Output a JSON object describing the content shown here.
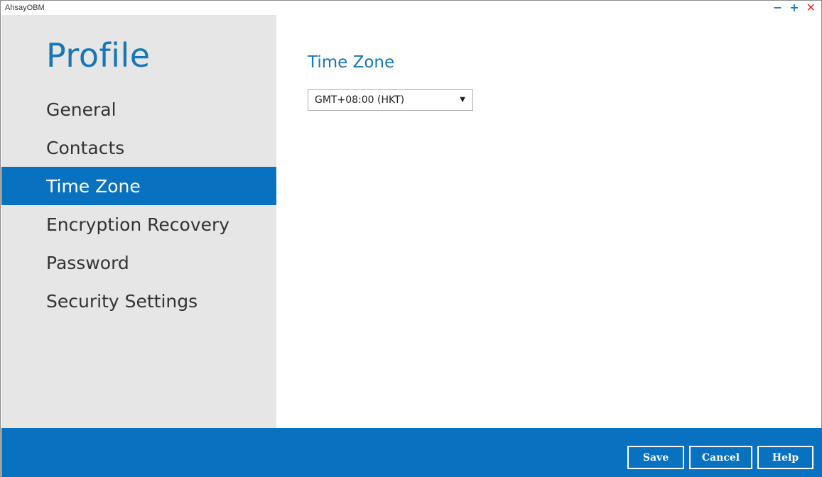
{
  "window": {
    "title": "AhsayOBM",
    "controls": {
      "minimize": "−",
      "maximize": "+",
      "close": "✕"
    }
  },
  "sidebar": {
    "title": "Profile",
    "items": [
      {
        "label": "General",
        "active": false
      },
      {
        "label": "Contacts",
        "active": false
      },
      {
        "label": "Time Zone",
        "active": true
      },
      {
        "label": "Encryption Recovery",
        "active": false
      },
      {
        "label": "Password",
        "active": false
      },
      {
        "label": "Security Settings",
        "active": false
      }
    ]
  },
  "main": {
    "title": "Time Zone",
    "timezone_select": {
      "value": "GMT+08:00 (HKT)",
      "chevron": "▼"
    }
  },
  "footer": {
    "save_label": "Save",
    "cancel_label": "Cancel",
    "help_label": "Help"
  },
  "colors": {
    "accent": "#0972c0",
    "title_blue": "#1576b8",
    "sidebar_bg": "#e6e6e6",
    "close_red": "#e8262a"
  }
}
